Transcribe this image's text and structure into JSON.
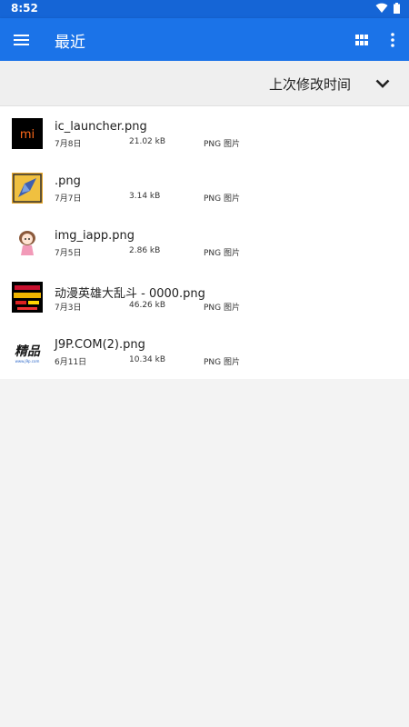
{
  "status": {
    "time": "8:52"
  },
  "app_bar": {
    "title": "最近"
  },
  "sort": {
    "label": "上次修改时间"
  },
  "thumbs": {
    "mi_text": "mi",
    "jingpin_text": "精品",
    "jingpin_url": "www.j9p.com"
  },
  "files": [
    {
      "name": "ic_launcher.png",
      "date": "7月8日",
      "size": "21.02 kB",
      "type": "PNG 图片"
    },
    {
      "name": ".png",
      "date": "7月7日",
      "size": "3.14 kB",
      "type": "PNG 图片"
    },
    {
      "name": "img_iapp.png",
      "date": "7月5日",
      "size": "2.86 kB",
      "type": "PNG 图片"
    },
    {
      "name": "动漫英雄大乱斗 - 0000.png",
      "date": "7月3日",
      "size": "46.26 kB",
      "type": "PNG 图片"
    },
    {
      "name": "J9P.COM(2).png",
      "date": "6月11日",
      "size": "10.34 kB",
      "type": "PNG 图片"
    }
  ]
}
